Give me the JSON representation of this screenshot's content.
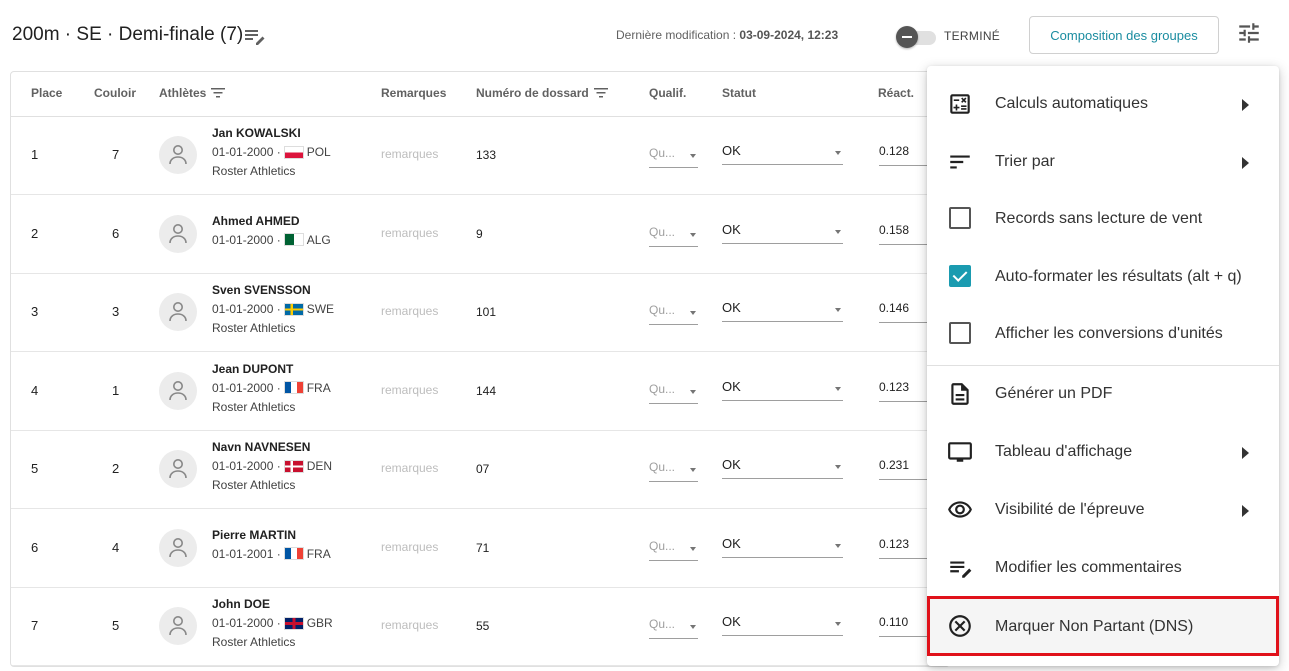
{
  "header": {
    "title": "200m · SE · Demi-finale (7)",
    "last_modified_label": "Dernière modification :",
    "last_modified_value": "03-09-2024, 12:23",
    "toggle_label": "TERMINÉ",
    "compose_button": "Composition des groupes"
  },
  "table": {
    "headers": {
      "place": "Place",
      "lane": "Couloir",
      "athletes": "Athlètes",
      "remarks": "Remarques",
      "bib": "Numéro de dossard",
      "qualif": "Qualif.",
      "status": "Statut",
      "reaction": "Réact."
    },
    "rows": [
      {
        "place": "1",
        "lane": "7",
        "name": "Jan KOWALSKI",
        "dob": "01-01-2000 ·",
        "country": "POL",
        "club": "Roster Athletics",
        "remark": "remarques",
        "bib": "133",
        "qualif": "Qu...",
        "status": "OK",
        "reaction": "0.128"
      },
      {
        "place": "2",
        "lane": "6",
        "name": "Ahmed AHMED",
        "dob": "01-01-2000 ·",
        "country": "ALG",
        "club": "",
        "remark": "remarques",
        "bib": "9",
        "qualif": "Qu...",
        "status": "OK",
        "reaction": "0.158"
      },
      {
        "place": "3",
        "lane": "3",
        "name": "Sven SVENSSON",
        "dob": "01-01-2000 ·",
        "country": "SWE",
        "club": "Roster Athletics",
        "remark": "remarques",
        "bib": "101",
        "qualif": "Qu...",
        "status": "OK",
        "reaction": "0.146"
      },
      {
        "place": "4",
        "lane": "1",
        "name": "Jean DUPONT",
        "dob": "01-01-2000 ·",
        "country": "FRA",
        "club": "Roster Athletics",
        "remark": "remarques",
        "bib": "144",
        "qualif": "Qu...",
        "status": "OK",
        "reaction": "0.123"
      },
      {
        "place": "5",
        "lane": "2",
        "name": "Navn NAVNESEN",
        "dob": "01-01-2000 ·",
        "country": "DEN",
        "club": "Roster Athletics",
        "remark": "remarques",
        "bib": "07",
        "qualif": "Qu...",
        "status": "OK",
        "reaction": "0.231"
      },
      {
        "place": "6",
        "lane": "4",
        "name": "Pierre MARTIN",
        "dob": "01-01-2001 ·",
        "country": "FRA",
        "club": "",
        "remark": "remarques",
        "bib": "71",
        "qualif": "Qu...",
        "status": "OK",
        "reaction": "0.123"
      },
      {
        "place": "7",
        "lane": "5",
        "name": "John DOE",
        "dob": "01-01-2000 ·",
        "country": "GBR",
        "club": "Roster Athletics",
        "remark": "remarques",
        "bib": "55",
        "qualif": "Qu...",
        "status": "OK",
        "reaction": "0.110"
      }
    ]
  },
  "menu": {
    "items": [
      {
        "label": "Calculs automatiques",
        "icon": "calculator-icon",
        "submenu": true
      },
      {
        "label": "Trier par",
        "icon": "sort-icon",
        "submenu": true
      },
      {
        "label": "Records sans lecture de vent",
        "icon": "checkbox",
        "checked": false
      },
      {
        "label": "Auto-formater les résultats (alt + q)",
        "icon": "checkbox",
        "checked": true
      },
      {
        "label": "Afficher les conversions d'unités",
        "icon": "checkbox",
        "checked": false
      },
      {
        "label": "Générer un PDF",
        "icon": "document-icon",
        "submenu": false
      },
      {
        "label": "Tableau d'affichage",
        "icon": "monitor-icon",
        "submenu": true
      },
      {
        "label": "Visibilité de l'épreuve",
        "icon": "eye-icon",
        "submenu": true
      },
      {
        "label": "Modifier les commentaires",
        "icon": "edit-notes-icon",
        "submenu": false
      },
      {
        "label": "Marquer Non Partant (DNS)",
        "icon": "cancel-circle-icon",
        "submenu": false
      }
    ]
  },
  "colors": {
    "accent": "#1a9bb0",
    "highlight": "#e0111a"
  }
}
